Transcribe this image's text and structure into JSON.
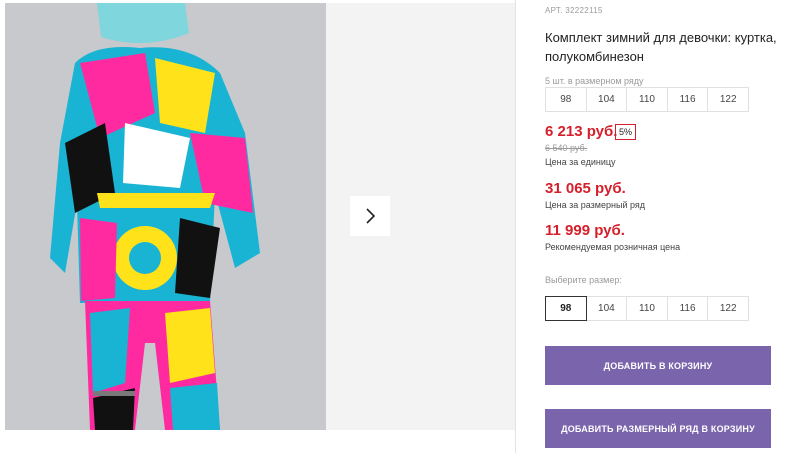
{
  "product": {
    "sku": "АРТ. 32222115",
    "title": "Комплект зимний для девочки: куртка, полукомбинезон"
  },
  "size_row": {
    "caption": "5 шт. в размерном ряду",
    "sizes": [
      "98",
      "104",
      "110",
      "116",
      "122"
    ]
  },
  "pricing": {
    "price": "6 213 руб.",
    "discount": "5%",
    "old_price": "6 540 руб.",
    "price_note": "Цена за единицу",
    "row_price": "31 065 руб.",
    "row_price_note": "Цена за размерный ряд",
    "rrp": "11 999 руб.",
    "rrp_note": "Рекомендуемая розничная цена"
  },
  "size_select": {
    "caption": "Выберите размер:",
    "sizes": [
      "98",
      "104",
      "110",
      "116",
      "122"
    ],
    "selected": "98"
  },
  "actions": {
    "add_to_cart": "Добавить в корзину",
    "add_row_to_cart": "Добавить размерный ряд в корзину"
  },
  "gallery": {
    "next_icon": "chevron-right-icon"
  },
  "colors": {
    "price_red": "#d51f2a",
    "button_purple": "#7a65ad"
  }
}
